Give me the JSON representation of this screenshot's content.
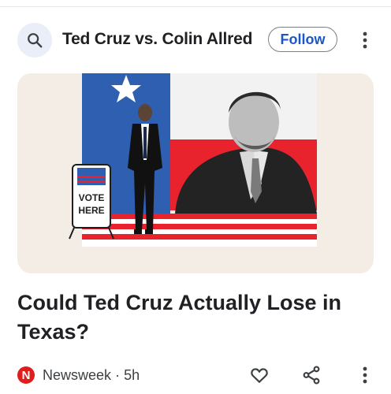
{
  "header": {
    "search_icon": "search-icon",
    "topic_title": "Ted Cruz vs. Colin Allred",
    "follow_label": "Follow",
    "more_icon": "more-vert-icon"
  },
  "card": {
    "image_description": "Collage of Colin Allred walking beside a VOTE HERE sign and Ted Cruz in front of a Texas flag",
    "vote_sign_line1": "VOTE",
    "vote_sign_line2": "HERE",
    "headline": "Could Ted Cruz Actually Lose in Texas?"
  },
  "footer": {
    "source_logo_letter": "N",
    "source_name": "Newsweek",
    "separator": "·",
    "time_ago": "5h",
    "like_icon": "heart-outline-icon",
    "share_icon": "share-icon",
    "more_icon": "more-vert-icon"
  },
  "colors": {
    "follow_text": "#1a57c8",
    "flag_red": "#e8232e",
    "flag_blue": "#2e5fb0",
    "image_bg": "#f4ede5",
    "newsweek_red": "#e01d1d"
  }
}
